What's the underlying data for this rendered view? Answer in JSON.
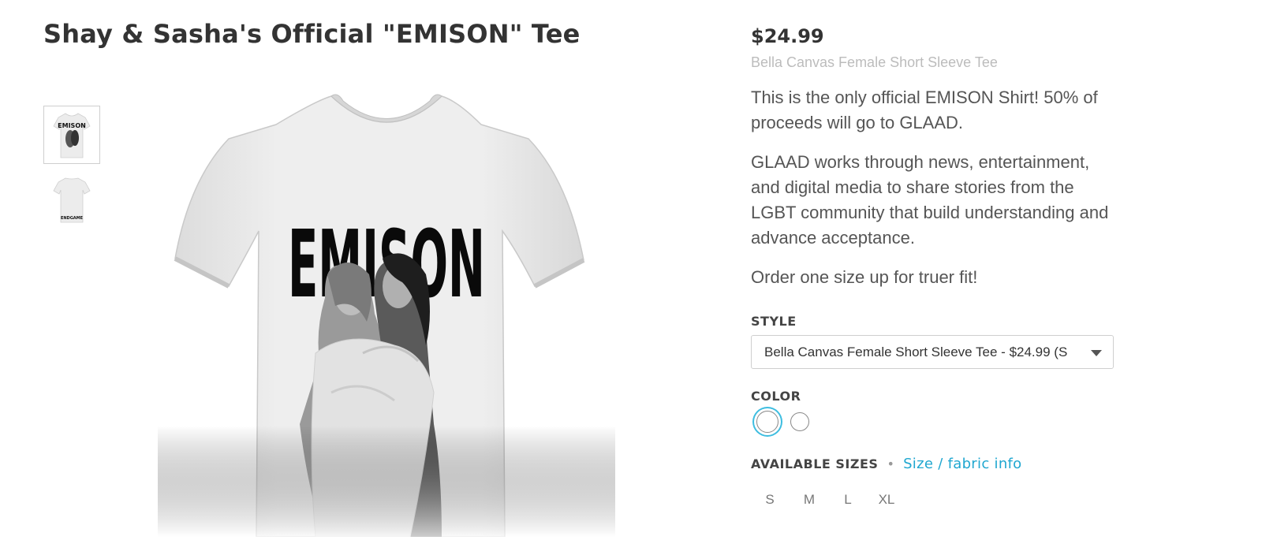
{
  "product": {
    "title": "Shay & Sasha's Official \"EMISON\" Tee",
    "shirt_text": "EMISON",
    "thumb_alt_text": "ENDGAME"
  },
  "details": {
    "price": "$24.99",
    "style_name": "Bella Canvas Female Short Sleeve Tee",
    "description": [
      "This is the only official EMISON Shirt! 50% of proceeds will go to GLAAD.",
      "GLAAD works through news, entertainment, and digital media to share stories from the LGBT community that build understanding and advance acceptance.",
      "Order one size up for truer fit!"
    ]
  },
  "style": {
    "label": "STYLE",
    "selected": "Bella Canvas Female Short Sleeve Tee - $24.99 (S"
  },
  "color": {
    "label": "COLOR",
    "swatches": [
      {
        "name": "White",
        "hex": "#ffffff",
        "selected": true
      },
      {
        "name": "White",
        "hex": "#ffffff",
        "selected": false
      }
    ],
    "accent": "#3dbde0"
  },
  "sizes": {
    "label": "AVAILABLE SIZES",
    "separator": "•",
    "info_link": "Size / fabric info",
    "options": [
      "S",
      "M",
      "L",
      "XL"
    ]
  }
}
